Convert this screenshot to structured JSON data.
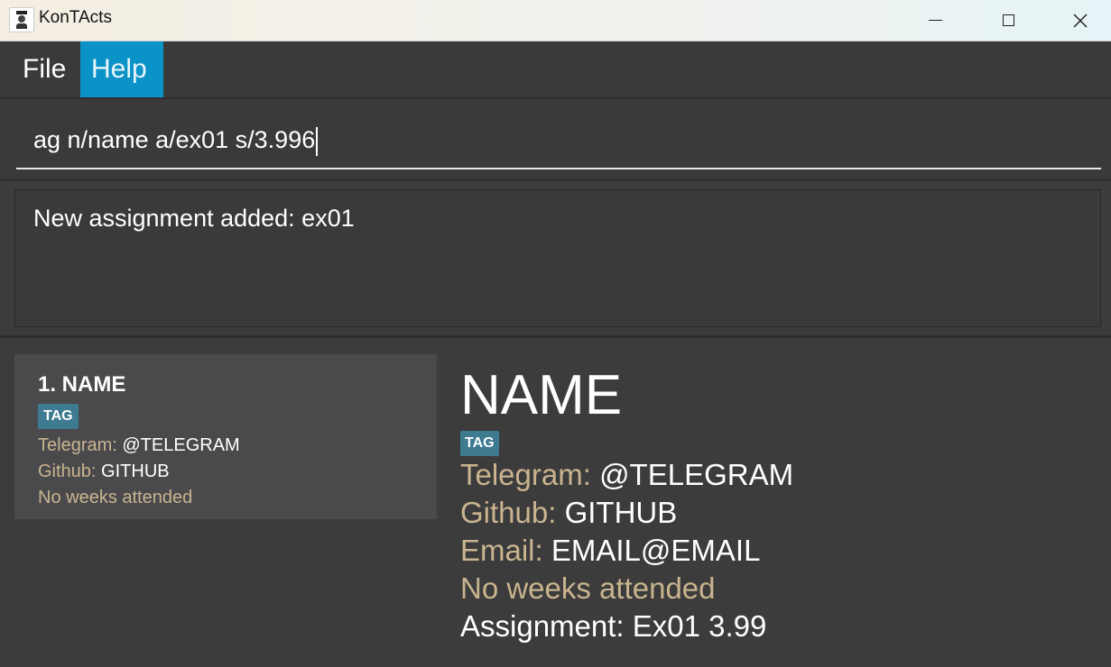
{
  "window": {
    "title": "KonTActs",
    "icon": "graduate-icon",
    "controls": {
      "minimize": "minimize-icon",
      "maximize": "maximize-icon",
      "close": "close-icon"
    }
  },
  "menu": {
    "file": "File",
    "help": "Help"
  },
  "command": {
    "value": "ag n/name a/ex01 s/3.996"
  },
  "result": {
    "message": "New assignment added: ex01"
  },
  "list": [
    {
      "index_name": "1. NAME",
      "tag": "TAG",
      "telegram_label": "Telegram:",
      "telegram": "@TELEGRAM",
      "github_label": "Github:",
      "github": "GITHUB",
      "weeks": "No weeks attended"
    }
  ],
  "detail": {
    "name": "NAME",
    "tag": "TAG",
    "telegram_label": "Telegram:",
    "telegram": "@TELEGRAM",
    "github_label": "Github:",
    "github": "GITHUB",
    "email_label": "Email:",
    "email": "EMAIL@EMAIL",
    "weeks": "No weeks attended",
    "assignment_label": "Assignment:",
    "assignment": "Ex01 3.99"
  },
  "colors": {
    "background": "#3c3c3c",
    "accent": "#0b93c8",
    "tag": "#3e7b91",
    "label": "#c9b48f",
    "card": "#4a4a4d"
  }
}
